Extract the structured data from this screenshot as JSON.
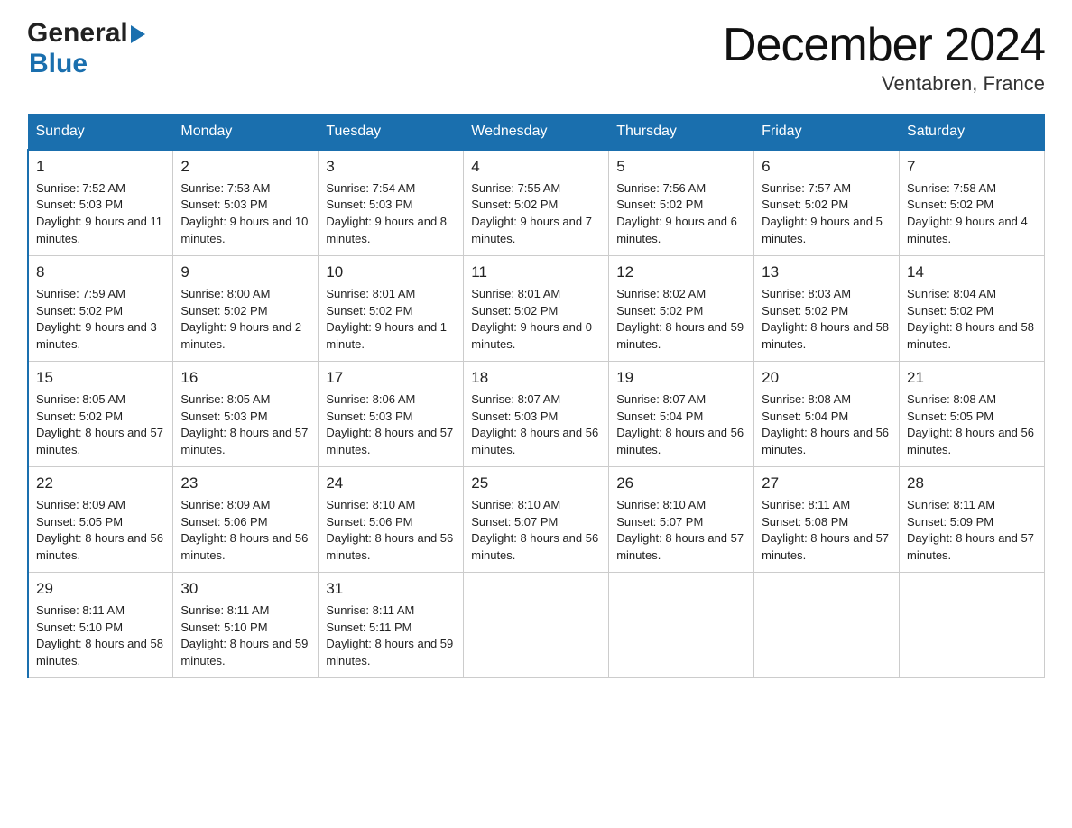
{
  "header": {
    "logo_general": "General",
    "logo_blue": "Blue",
    "month_title": "December 2024",
    "location": "Ventabren, France"
  },
  "days_of_week": [
    "Sunday",
    "Monday",
    "Tuesday",
    "Wednesday",
    "Thursday",
    "Friday",
    "Saturday"
  ],
  "weeks": [
    [
      {
        "num": "1",
        "sunrise": "7:52 AM",
        "sunset": "5:03 PM",
        "daylight": "9 hours and 11 minutes."
      },
      {
        "num": "2",
        "sunrise": "7:53 AM",
        "sunset": "5:03 PM",
        "daylight": "9 hours and 10 minutes."
      },
      {
        "num": "3",
        "sunrise": "7:54 AM",
        "sunset": "5:03 PM",
        "daylight": "9 hours and 8 minutes."
      },
      {
        "num": "4",
        "sunrise": "7:55 AM",
        "sunset": "5:02 PM",
        "daylight": "9 hours and 7 minutes."
      },
      {
        "num": "5",
        "sunrise": "7:56 AM",
        "sunset": "5:02 PM",
        "daylight": "9 hours and 6 minutes."
      },
      {
        "num": "6",
        "sunrise": "7:57 AM",
        "sunset": "5:02 PM",
        "daylight": "9 hours and 5 minutes."
      },
      {
        "num": "7",
        "sunrise": "7:58 AM",
        "sunset": "5:02 PM",
        "daylight": "9 hours and 4 minutes."
      }
    ],
    [
      {
        "num": "8",
        "sunrise": "7:59 AM",
        "sunset": "5:02 PM",
        "daylight": "9 hours and 3 minutes."
      },
      {
        "num": "9",
        "sunrise": "8:00 AM",
        "sunset": "5:02 PM",
        "daylight": "9 hours and 2 minutes."
      },
      {
        "num": "10",
        "sunrise": "8:01 AM",
        "sunset": "5:02 PM",
        "daylight": "9 hours and 1 minute."
      },
      {
        "num": "11",
        "sunrise": "8:01 AM",
        "sunset": "5:02 PM",
        "daylight": "9 hours and 0 minutes."
      },
      {
        "num": "12",
        "sunrise": "8:02 AM",
        "sunset": "5:02 PM",
        "daylight": "8 hours and 59 minutes."
      },
      {
        "num": "13",
        "sunrise": "8:03 AM",
        "sunset": "5:02 PM",
        "daylight": "8 hours and 58 minutes."
      },
      {
        "num": "14",
        "sunrise": "8:04 AM",
        "sunset": "5:02 PM",
        "daylight": "8 hours and 58 minutes."
      }
    ],
    [
      {
        "num": "15",
        "sunrise": "8:05 AM",
        "sunset": "5:02 PM",
        "daylight": "8 hours and 57 minutes."
      },
      {
        "num": "16",
        "sunrise": "8:05 AM",
        "sunset": "5:03 PM",
        "daylight": "8 hours and 57 minutes."
      },
      {
        "num": "17",
        "sunrise": "8:06 AM",
        "sunset": "5:03 PM",
        "daylight": "8 hours and 57 minutes."
      },
      {
        "num": "18",
        "sunrise": "8:07 AM",
        "sunset": "5:03 PM",
        "daylight": "8 hours and 56 minutes."
      },
      {
        "num": "19",
        "sunrise": "8:07 AM",
        "sunset": "5:04 PM",
        "daylight": "8 hours and 56 minutes."
      },
      {
        "num": "20",
        "sunrise": "8:08 AM",
        "sunset": "5:04 PM",
        "daylight": "8 hours and 56 minutes."
      },
      {
        "num": "21",
        "sunrise": "8:08 AM",
        "sunset": "5:05 PM",
        "daylight": "8 hours and 56 minutes."
      }
    ],
    [
      {
        "num": "22",
        "sunrise": "8:09 AM",
        "sunset": "5:05 PM",
        "daylight": "8 hours and 56 minutes."
      },
      {
        "num": "23",
        "sunrise": "8:09 AM",
        "sunset": "5:06 PM",
        "daylight": "8 hours and 56 minutes."
      },
      {
        "num": "24",
        "sunrise": "8:10 AM",
        "sunset": "5:06 PM",
        "daylight": "8 hours and 56 minutes."
      },
      {
        "num": "25",
        "sunrise": "8:10 AM",
        "sunset": "5:07 PM",
        "daylight": "8 hours and 56 minutes."
      },
      {
        "num": "26",
        "sunrise": "8:10 AM",
        "sunset": "5:07 PM",
        "daylight": "8 hours and 57 minutes."
      },
      {
        "num": "27",
        "sunrise": "8:11 AM",
        "sunset": "5:08 PM",
        "daylight": "8 hours and 57 minutes."
      },
      {
        "num": "28",
        "sunrise": "8:11 AM",
        "sunset": "5:09 PM",
        "daylight": "8 hours and 57 minutes."
      }
    ],
    [
      {
        "num": "29",
        "sunrise": "8:11 AM",
        "sunset": "5:10 PM",
        "daylight": "8 hours and 58 minutes."
      },
      {
        "num": "30",
        "sunrise": "8:11 AM",
        "sunset": "5:10 PM",
        "daylight": "8 hours and 59 minutes."
      },
      {
        "num": "31",
        "sunrise": "8:11 AM",
        "sunset": "5:11 PM",
        "daylight": "8 hours and 59 minutes."
      },
      null,
      null,
      null,
      null
    ]
  ]
}
